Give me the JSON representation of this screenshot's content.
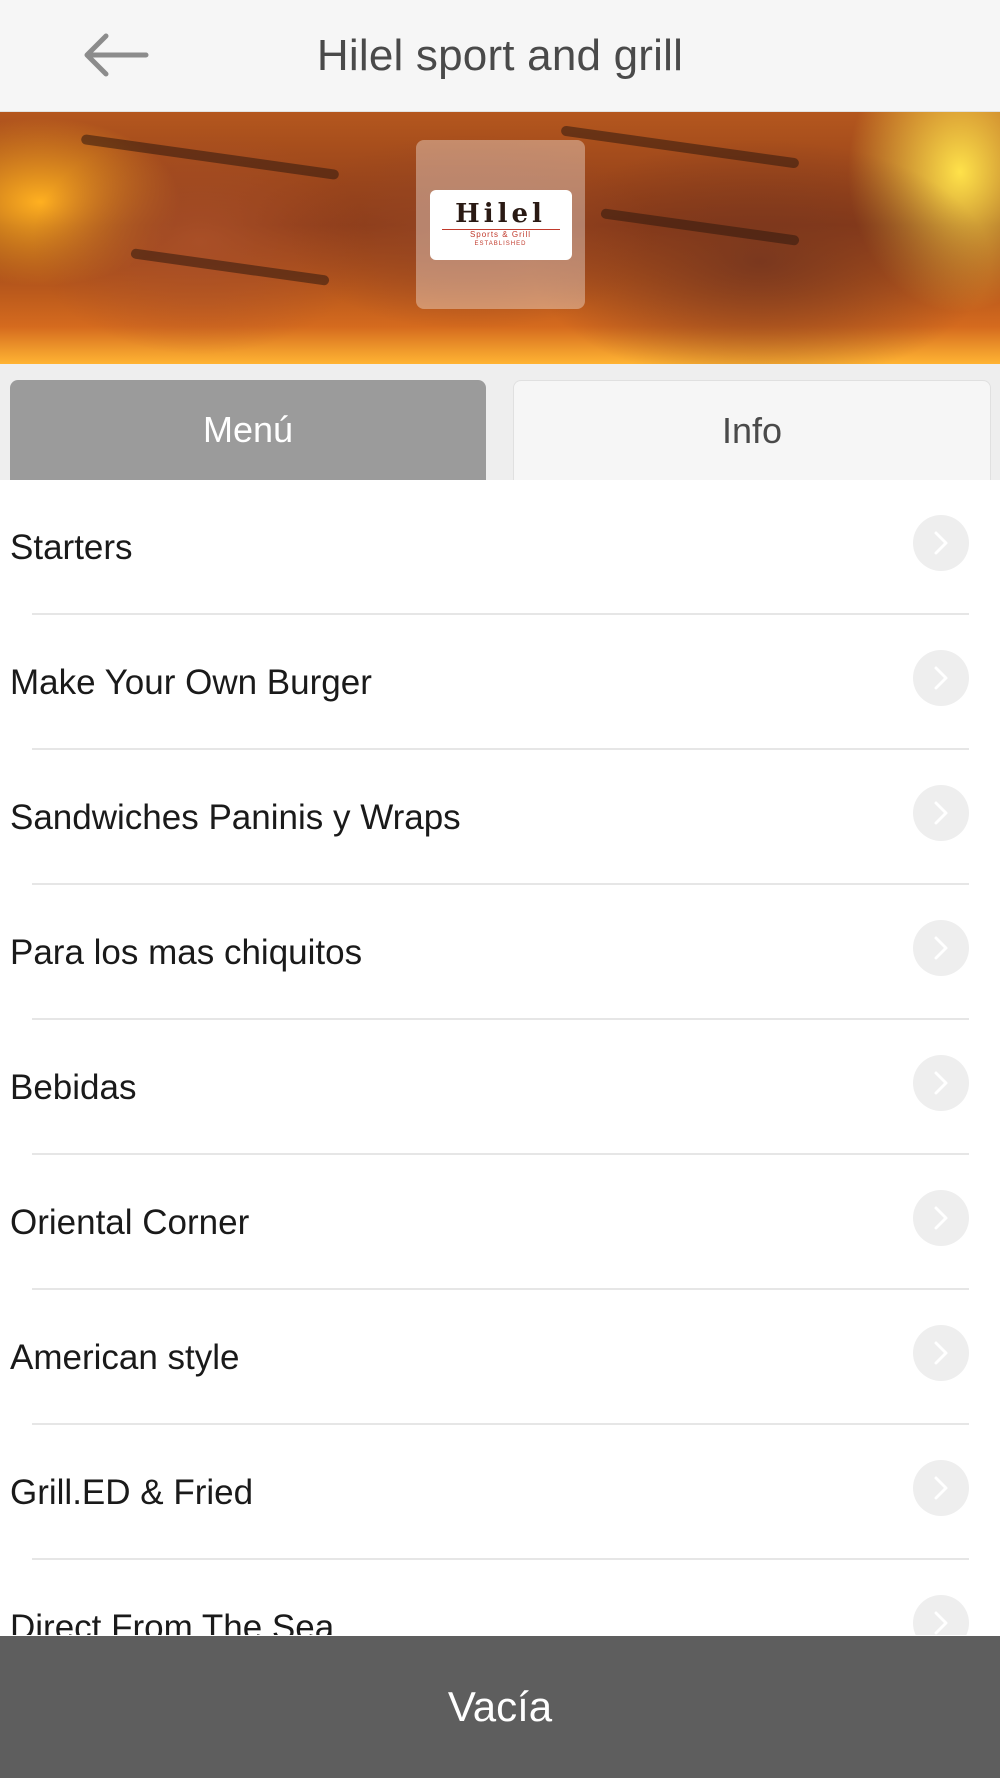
{
  "header": {
    "title": "Hilel sport and grill",
    "back_icon": "arrow-left-icon"
  },
  "hero": {
    "logo_name": "Hilel",
    "logo_subtitle": "Sports & Grill",
    "logo_subtitle2": "ESTABLISHED"
  },
  "tabs": [
    {
      "label": "Menú",
      "active": true
    },
    {
      "label": "Info",
      "active": false
    }
  ],
  "menu": {
    "items": [
      {
        "label": "Starters"
      },
      {
        "label": "Make Your Own Burger"
      },
      {
        "label": "Sandwiches Paninis y Wraps"
      },
      {
        "label": "Para los mas chiquitos"
      },
      {
        "label": "Bebidas"
      },
      {
        "label": "Oriental Corner"
      },
      {
        "label": "American style"
      },
      {
        "label": "Grill.ED & Fried"
      },
      {
        "label": "Direct From The Sea"
      }
    ],
    "chevron_icon": "chevron-right-icon"
  },
  "footer": {
    "cart_label": "Vacía"
  },
  "colors": {
    "header_bg": "#f6f6f6",
    "tab_active_bg": "#9b9b9b",
    "tab_inactive_bg": "#f6f6f6",
    "footer_bg": "#5e5e5e"
  }
}
